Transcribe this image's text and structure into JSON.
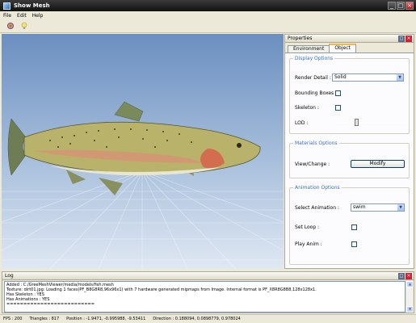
{
  "window": {
    "title": "Show Mesh"
  },
  "menu": [
    "File",
    "Edit",
    "Help"
  ],
  "toolbar": {
    "icons": [
      "camera-icon",
      "lightbulb-icon"
    ]
  },
  "properties": {
    "title": "Properties",
    "tabs": [
      "Environment",
      "Object"
    ],
    "active_tab": "Object",
    "display_options": {
      "legend": "Display Options",
      "render_detail_label": "Render Detail :",
      "render_detail_value": "Solid",
      "bounding_boxes_label": "Bounding Boxes :",
      "skeleton_label": "Skeleton :",
      "lod_label": "LOD :",
      "lod_fraction": 0.3
    },
    "materials_options": {
      "legend": "Materials Options",
      "view_change_label": "View/Change :",
      "modify_label": "Modify"
    },
    "animation_options": {
      "legend": "Animation Options",
      "select_animation_label": "Select Animation :",
      "select_animation_value": "swim",
      "set_loop_label": "Set Loop :",
      "play_anim_label": "Play Anim :"
    }
  },
  "log": {
    "title": "Log",
    "lines": [
      "Added : C:/GreeMeshViewer/media/models/fish.mesh",
      "Texture: dirt01.jpg: Loading 1 faces(PF_B8G8R8,96x96x1) with 7 hardware generated mipmaps from Image. Internal format is PF_X8R8G8B8,128x128x1.",
      "Has Skeleton : YES",
      "Has Animations : YES",
      "=========================="
    ]
  },
  "status": {
    "fps": "FPS : 200",
    "triangles": "Triangles : 817",
    "position": "Position : -1.9471, -0.995988, -9.53411",
    "direction": "Direction : 0.188094, 0.0898779, 0.978024"
  }
}
